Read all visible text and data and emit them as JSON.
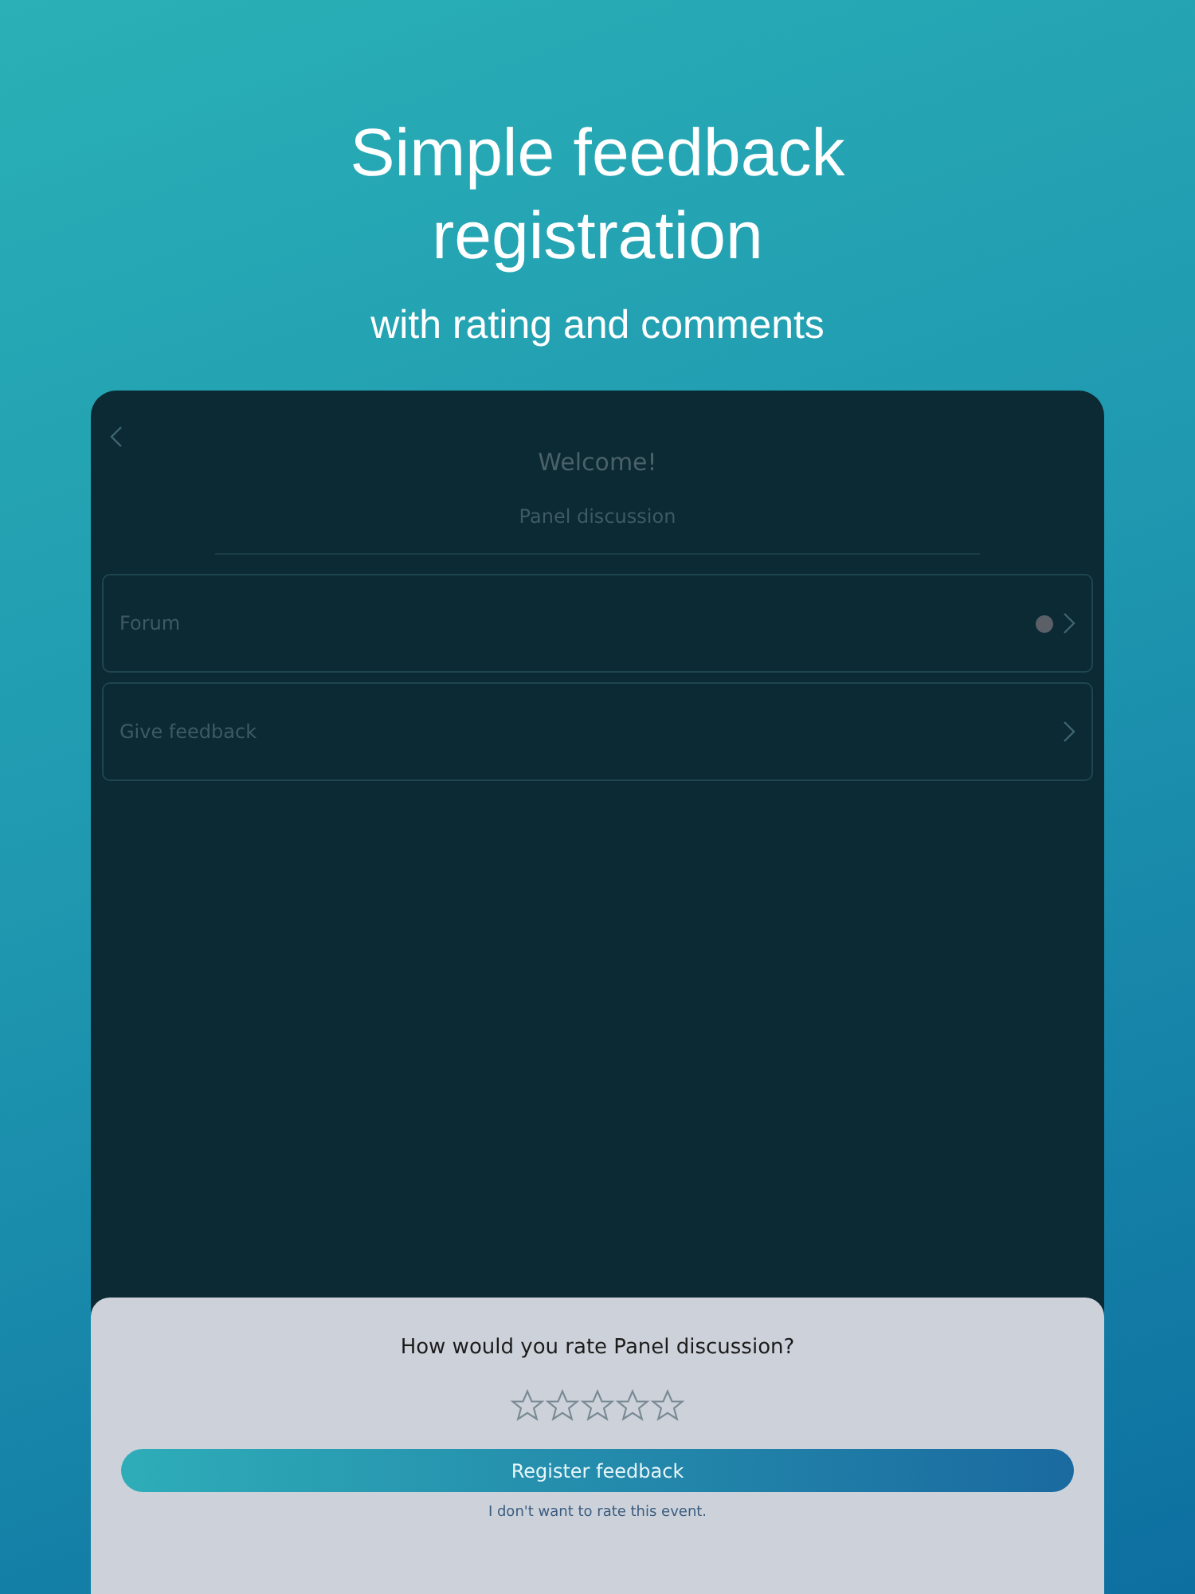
{
  "headline": {
    "title": "Simple feedback registration",
    "subtitle": "with rating and comments"
  },
  "screen": {
    "title": "Welcome!",
    "event": "Panel discussion",
    "menu": [
      {
        "label": "Forum",
        "dot": true
      },
      {
        "label": "Give feedback",
        "dot": false
      }
    ]
  },
  "rating_sheet": {
    "question": "How would you rate Panel discussion?",
    "stars": 0,
    "button": "Register feedback",
    "skip_link": "I don't want to rate this event."
  }
}
